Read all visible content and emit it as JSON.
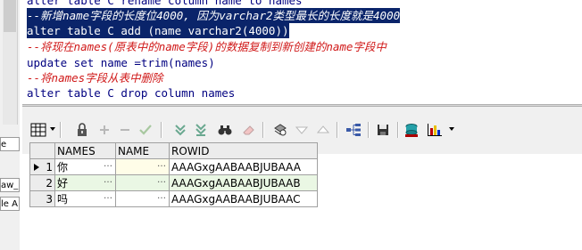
{
  "editor": {
    "lines": [
      {
        "text": "alter table C rename column name to names",
        "kind": "code"
      },
      {
        "text": "--新增name字段的长度位4000, 因为varchar2类型最长的长度就是4000",
        "kind": "comment"
      },
      {
        "text": "alter table C add (name varchar2(4000))",
        "kind": "code"
      },
      {
        "text": "--将现在names(原表中的name字段)的数据复制到新创建的name字段中",
        "kind": "comment"
      },
      {
        "text": "update set name =trim(names)",
        "kind": "code"
      },
      {
        "text": "--将names字段从表中删除",
        "kind": "comment"
      },
      {
        "text": "alter table C drop column names",
        "kind": "code"
      }
    ]
  },
  "left_fragments": [
    "e",
    "aw_",
    "le A"
  ],
  "toolbar": {
    "buttons": [
      "grid-icon",
      "lock-icon",
      "add-record-icon",
      "delete-record-icon",
      "post-icon",
      "fetch-next-icon",
      "fetch-last-icon",
      "find-icon",
      "clear-icon",
      "query-by-example-icon",
      "sort-descending-icon",
      "sort-ascending-icon",
      "tree-icon",
      "save-icon",
      "export-icon",
      "chart-icon"
    ]
  },
  "grid": {
    "columns": [
      "NAMES",
      "NAME",
      "ROWID"
    ],
    "rows": [
      {
        "num": "1",
        "names": "你",
        "name": "",
        "rowid": "AAAGxgAABAABJUBAAA"
      },
      {
        "num": "2",
        "names": "好",
        "name": "",
        "rowid": "AAAGxgAABAABJUBAAB"
      },
      {
        "num": "3",
        "names": "吗",
        "name": "",
        "rowid": "AAAGxgAABAABJUBAAC"
      }
    ],
    "ellipsis": "…"
  },
  "colors": {
    "selection": "#0a246a",
    "comment": "#d01818",
    "keyword": "#000080",
    "even_row": "#eaf7e4"
  }
}
